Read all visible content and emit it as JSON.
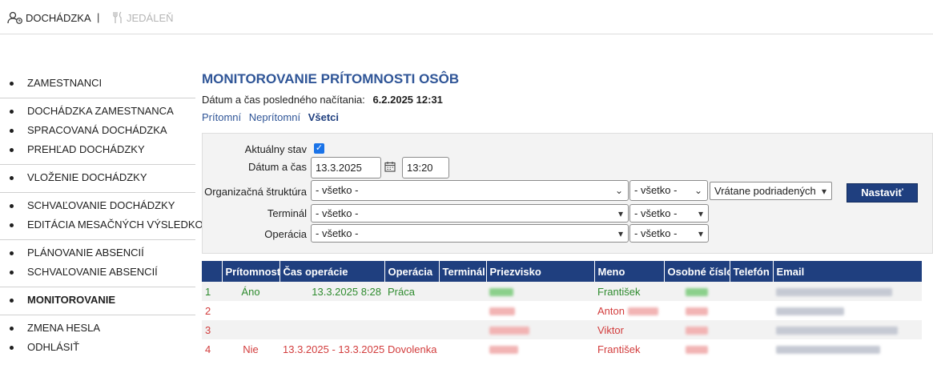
{
  "topbar": {
    "attendance_label": "DOCHÁDZKA",
    "separator": "|",
    "canteen_label": "JEDÁLEŇ"
  },
  "sidebar": {
    "groups": [
      [
        "ZAMESTNANCI"
      ],
      [
        "DOCHÁDZKA ZAMESTNANCA",
        "SPRACOVANÁ DOCHÁDZKA",
        "PREHĽAD DOCHÁDZKY"
      ],
      [
        "VLOŽENIE DOCHÁDZKY"
      ],
      [
        "SCHVAĽOVANIE DOCHÁDZKY",
        "EDITÁCIA MESAČNÝCH VÝSLEDKOV"
      ],
      [
        "PLÁNOVANIE ABSENCIÍ",
        "SCHVAĽOVANIE ABSENCIÍ"
      ],
      [
        "MONITOROVANIE"
      ],
      [
        "ZMENA HESLA",
        "ODHLÁSIŤ"
      ]
    ],
    "active": "MONITOROVANIE"
  },
  "main": {
    "title": "MONITOROVANIE PRÍTOMNOSTI OSÔB",
    "last_load_label": "Dátum a čas posledného načítania:",
    "last_load_value": "6.2.2025 12:31",
    "filter_links": [
      "Prítomní",
      "Neprítomní",
      "Všetci"
    ],
    "filter_selected": "Všetci"
  },
  "filters": {
    "current_state_label": "Aktuálny stav",
    "current_state_checked": true,
    "datetime_label": "Dátum a čas",
    "date_value": "13.3.2025",
    "time_value": "13:20",
    "org_label": "Organizačná štruktúra",
    "org_value": "- všetko -",
    "org_value2": "- všetko -",
    "org_scope": "Vrátane podriadených",
    "terminal_label": "Terminál",
    "terminal_value": "- všetko -",
    "terminal_value2": "- všetko -",
    "operation_label": "Operácia",
    "operation_value": "- všetko -",
    "operation_value2": "- všetko -",
    "apply_button": "Nastaviť"
  },
  "table": {
    "headers": [
      "",
      "Prítomnosť",
      "Čas operácie",
      "Operácia",
      "Terminál",
      "Priezvisko",
      "Meno",
      "Osobné číslo",
      "Telefón",
      "Email"
    ],
    "rows": [
      {
        "num": "1",
        "presence": "Áno",
        "time": "13.3.2025 8:28",
        "operation": "Práca",
        "terminal": "",
        "first_name": "František",
        "status": "green"
      },
      {
        "num": "2",
        "presence": "",
        "time": "",
        "operation": "",
        "terminal": "",
        "first_name": "Anton",
        "status": "red"
      },
      {
        "num": "3",
        "presence": "",
        "time": "",
        "operation": "",
        "terminal": "",
        "first_name": "Viktor",
        "status": "red"
      },
      {
        "num": "4",
        "presence": "Nie",
        "time": "13.3.2025 - 13.3.2025",
        "operation": "Dovolenka",
        "terminal": "",
        "first_name": "František",
        "status": "red"
      }
    ]
  },
  "colors": {
    "title_blue": "#2f5597",
    "header_navy": "#1f3f7f",
    "present_green": "#2e8b2e",
    "absent_red": "#d23c3c"
  }
}
